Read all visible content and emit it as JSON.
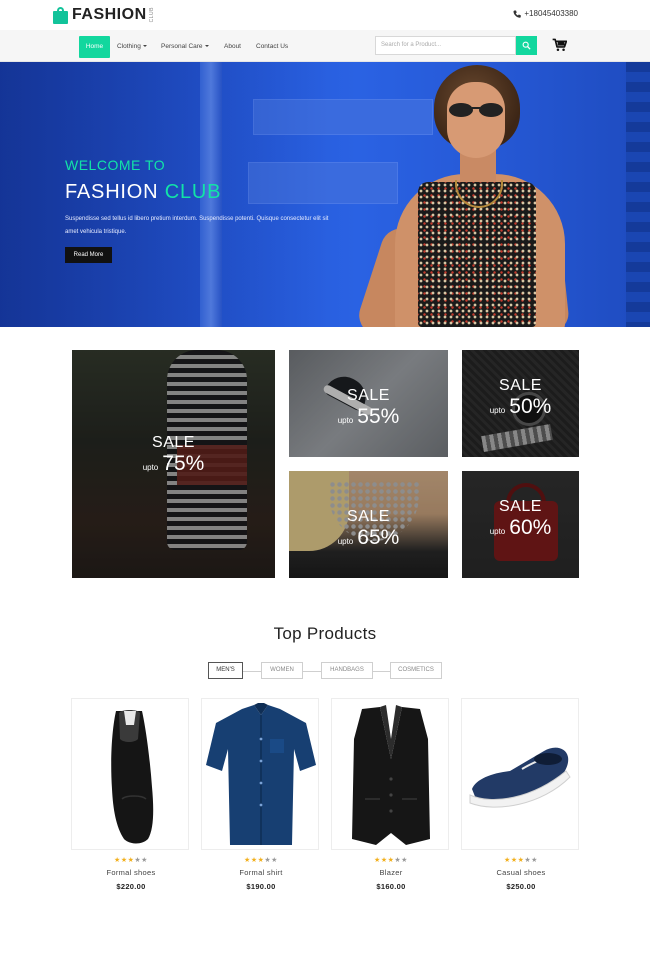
{
  "brand": {
    "name": "FASHION",
    "sub": "CLUB"
  },
  "contact": {
    "phone": "+18045403380"
  },
  "nav": {
    "items": [
      {
        "label": "Home",
        "active": true,
        "dropdown": false
      },
      {
        "label": "Clothing",
        "active": false,
        "dropdown": true
      },
      {
        "label": "Personal Care",
        "active": false,
        "dropdown": true
      },
      {
        "label": "About",
        "active": false,
        "dropdown": false
      },
      {
        "label": "Contact Us",
        "active": false,
        "dropdown": false
      }
    ],
    "search_placeholder": "Search for a Product..."
  },
  "hero": {
    "kicker": "WELCOME TO",
    "title_main": "FASHION",
    "title_accent": "CLUB",
    "description": "Suspendisse sed tellus id libero pretium interdum. Suspendisse potenti. Quisque consectetur elit sit amet vehicula tristique.",
    "button_label": "Read More"
  },
  "sales": [
    {
      "sale": "SALE",
      "upto": "upto",
      "percent": "75%"
    },
    {
      "sale": "SALE",
      "upto": "upto",
      "percent": "55%"
    },
    {
      "sale": "SALE",
      "upto": "upto",
      "percent": "50%"
    },
    {
      "sale": "SALE",
      "upto": "upto",
      "percent": "65%"
    },
    {
      "sale": "SALE",
      "upto": "upto",
      "percent": "60%"
    }
  ],
  "top_products": {
    "title": "Top Products",
    "tabs": [
      "MEN'S",
      "WOMEN",
      "HANDBAGS",
      "COSMETICS"
    ],
    "active_tab": "MEN'S",
    "products": [
      {
        "name": "Formal shoes",
        "price": "$220.00",
        "rating": 3,
        "max": 5,
        "icon": "shoe"
      },
      {
        "name": "Formal shirt",
        "price": "$190.00",
        "rating": 3,
        "max": 5,
        "icon": "shirt"
      },
      {
        "name": "Blazer",
        "price": "$160.00",
        "rating": 3,
        "max": 5,
        "icon": "vest"
      },
      {
        "name": "Casual shoes",
        "price": "$250.00",
        "rating": 3,
        "max": 5,
        "icon": "sneaker"
      }
    ]
  },
  "colors": {
    "accent": "#12d79e",
    "hero_blue": "#1c4cc4",
    "star": "#f2b01e"
  }
}
